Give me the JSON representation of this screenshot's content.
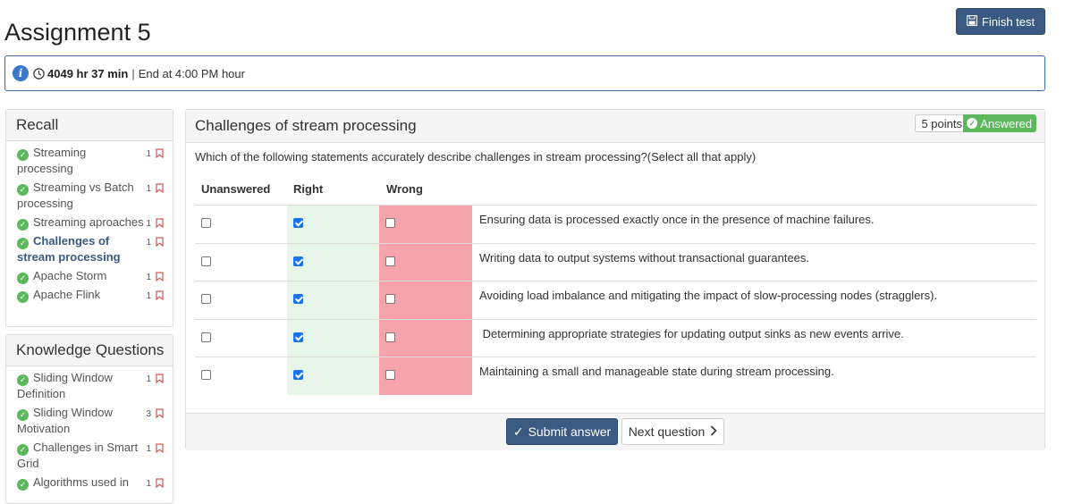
{
  "page": {
    "title": "Assignment 5"
  },
  "header": {
    "finish_label": "Finish test"
  },
  "info": {
    "timer": "4049 hr 37 min",
    "separator": "|",
    "end_text": "End at 4:00 PM hour"
  },
  "recall": {
    "title": "Recall",
    "items": [
      {
        "label": "Streaming processing",
        "count": "1",
        "active": false
      },
      {
        "label": "Streaming vs Batch processing",
        "count": "1",
        "active": false
      },
      {
        "label": "Streaming aproaches",
        "count": "1",
        "active": false
      },
      {
        "label": "Challenges of stream processing",
        "count": "1",
        "active": true
      },
      {
        "label": "Apache Storm",
        "count": "1",
        "active": false
      },
      {
        "label": "Apache Flink",
        "count": "1",
        "active": false
      }
    ]
  },
  "knowledge": {
    "title": "Knowledge Questions",
    "items": [
      {
        "label": "Sliding Window Definition",
        "count": "1"
      },
      {
        "label": "Sliding Window Motivation",
        "count": "3"
      },
      {
        "label": "Challenges in Smart Grid",
        "count": "1"
      },
      {
        "label": "Algorithms used in",
        "count": "1"
      }
    ]
  },
  "question": {
    "title": "Challenges of stream processing",
    "points": "5 points",
    "status": "Answered",
    "text": "Which of the following statements accurately describe challenges in stream processing?(Select all that apply)",
    "columns": {
      "unanswered": "Unanswered",
      "right": "Right",
      "wrong": "Wrong"
    },
    "options": [
      {
        "text": "Ensuring data is processed exactly once in the presence of machine failures.",
        "selected": "right"
      },
      {
        "text": "Writing data to output systems without transactional guarantees.",
        "selected": "right"
      },
      {
        "text": "Avoiding load imbalance and mitigating the impact of slow-processing nodes (stragglers).",
        "selected": "right"
      },
      {
        "text": " Determining appropriate strategies for updating output sinks as new events arrive.",
        "selected": "right"
      },
      {
        "text": "Maintaining a small and manageable state during stream processing.",
        "selected": "right"
      }
    ]
  },
  "footer": {
    "submit_label": "Submit answer",
    "next_label": "Next question"
  },
  "colors": {
    "primary": "#3a5a82",
    "success": "#5cb85c",
    "right_bg": "#e8f5e9",
    "wrong_bg": "#f7a3ab"
  }
}
